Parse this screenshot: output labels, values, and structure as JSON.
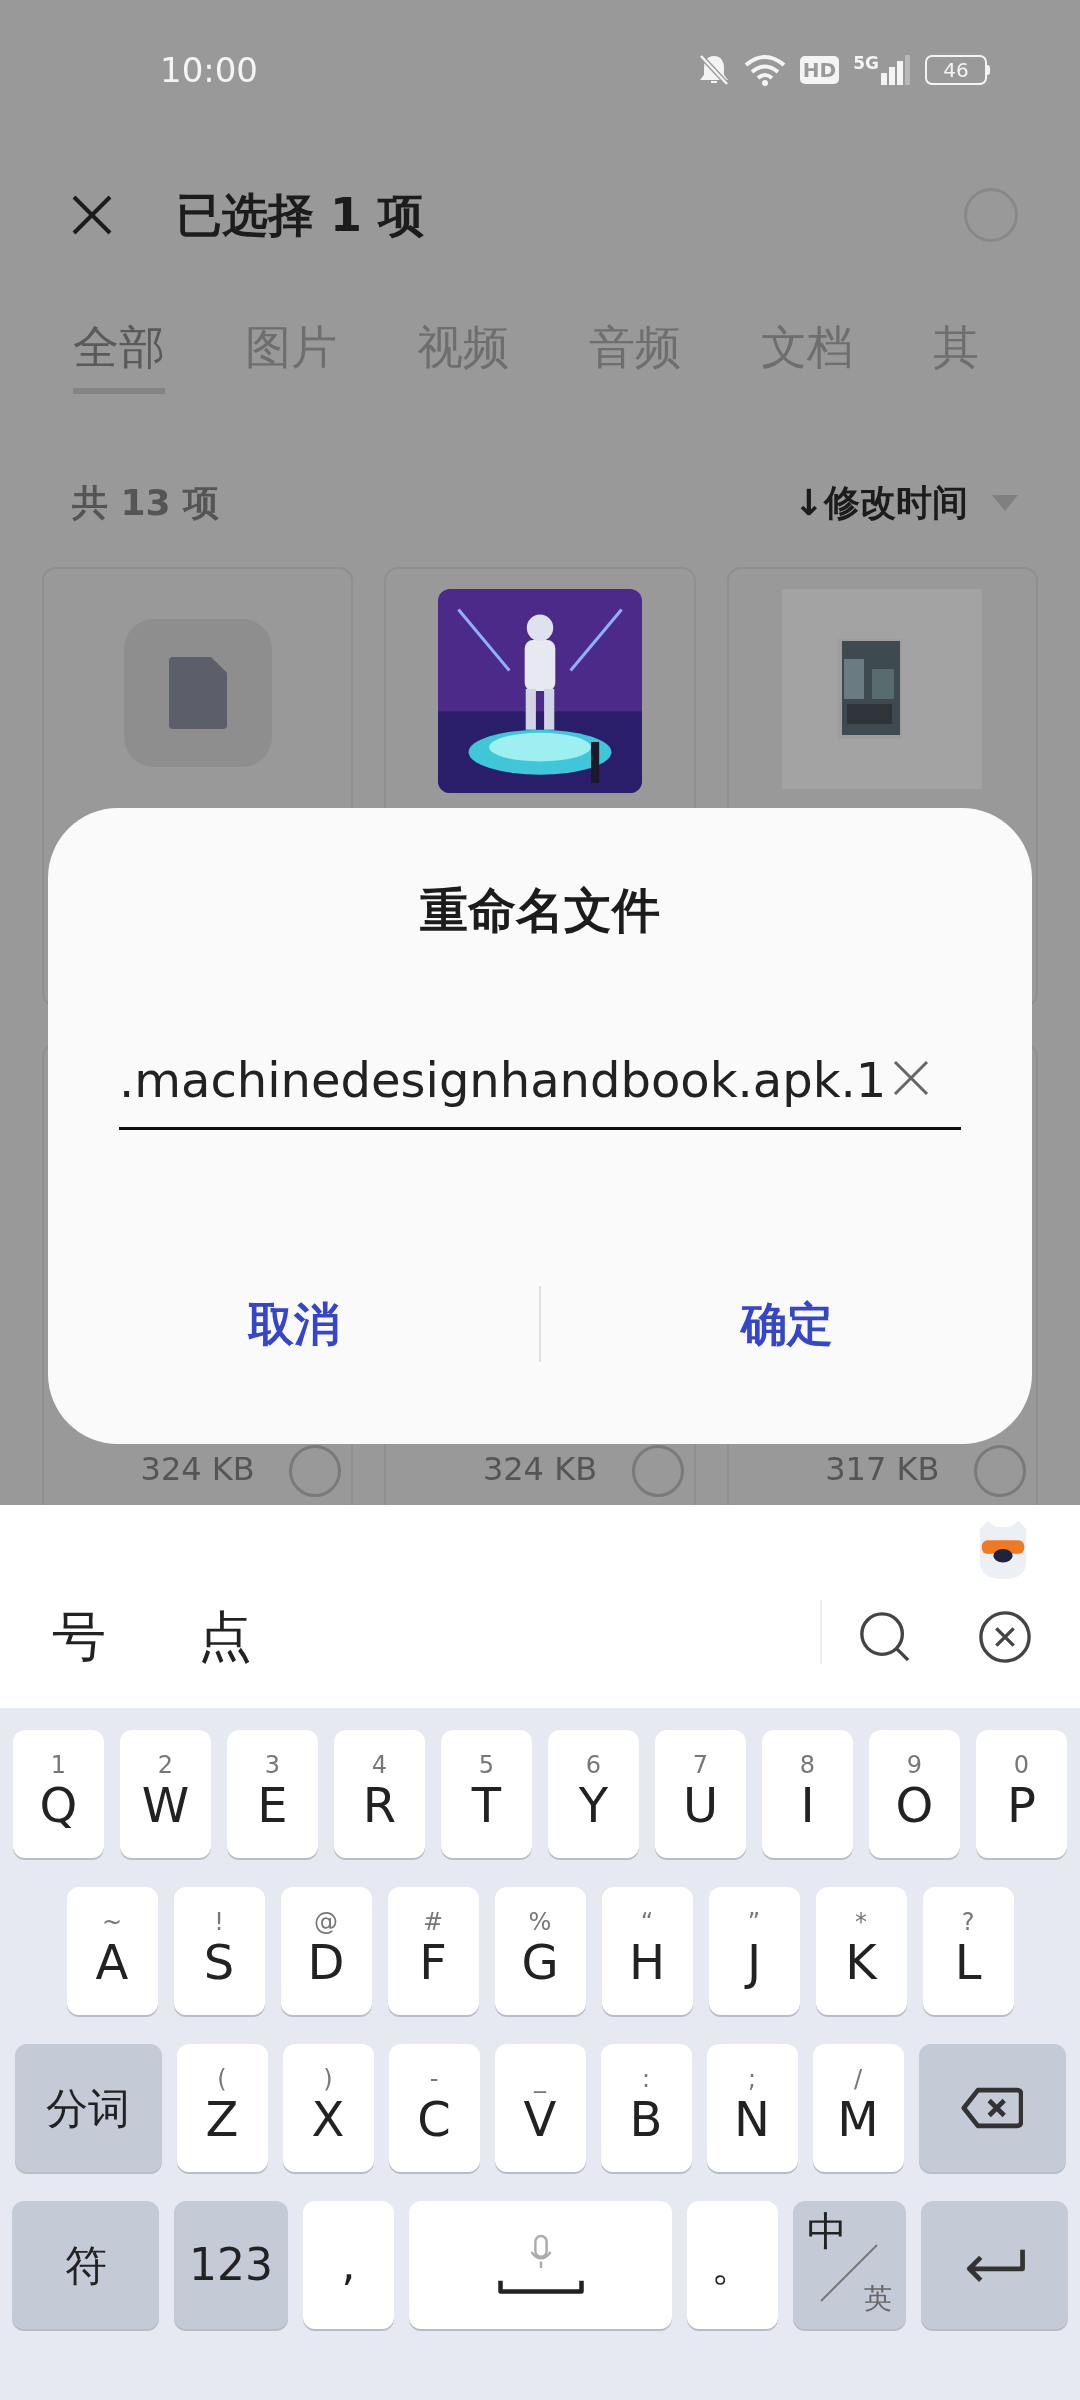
{
  "status_bar": {
    "time": "10:00",
    "network_badge": "HD",
    "network_type": "5G",
    "battery": "46"
  },
  "header": {
    "title": "已选择 1 项",
    "all_selected": false
  },
  "tabs": [
    {
      "label": "全部",
      "selected": true
    },
    {
      "label": "图片",
      "selected": false
    },
    {
      "label": "视频",
      "selected": false
    },
    {
      "label": "音频",
      "selected": false
    },
    {
      "label": "文档",
      "selected": false
    },
    {
      "label": "其",
      "selected": false
    }
  ],
  "list": {
    "count": "共 13 项",
    "sort_label": "↓修改时间"
  },
  "files_top": [
    {
      "kind": "document"
    },
    {
      "kind": "picture"
    },
    {
      "kind": "photo_print"
    }
  ],
  "files_bottom": [
    {
      "size": "324 KB",
      "selected": false
    },
    {
      "size": "324 KB",
      "selected": false
    },
    {
      "size": "317 KB",
      "selected": false
    }
  ],
  "dialog": {
    "title": "重命名文件",
    "value": ".machinedesignhandbook.apk.1",
    "buttons": [
      {
        "label": "取消"
      },
      {
        "label": "确定"
      }
    ]
  },
  "keyboard": {
    "candidates": [
      "号",
      "点"
    ],
    "rows": [
      {
        "keys": [
          {
            "kind": "letter",
            "label": "Q",
            "hint": "1"
          },
          {
            "kind": "letter",
            "label": "W",
            "hint": "2"
          },
          {
            "kind": "letter",
            "label": "E",
            "hint": "3"
          },
          {
            "kind": "letter",
            "label": "R",
            "hint": "4"
          },
          {
            "kind": "letter",
            "label": "T",
            "hint": "5"
          },
          {
            "kind": "letter",
            "label": "Y",
            "hint": "6"
          },
          {
            "kind": "letter",
            "label": "U",
            "hint": "7"
          },
          {
            "kind": "letter",
            "label": "I",
            "hint": "8"
          },
          {
            "kind": "letter",
            "label": "O",
            "hint": "9"
          },
          {
            "kind": "letter",
            "label": "P",
            "hint": "0"
          }
        ]
      },
      {
        "keys": [
          {
            "kind": "letter",
            "label": "A",
            "hint": "~"
          },
          {
            "kind": "letter",
            "label": "S",
            "hint": "!"
          },
          {
            "kind": "letter",
            "label": "D",
            "hint": "@"
          },
          {
            "kind": "letter",
            "label": "F",
            "hint": "#"
          },
          {
            "kind": "letter",
            "label": "G",
            "hint": "%"
          },
          {
            "kind": "letter",
            "label": "H",
            "hint": "“"
          },
          {
            "kind": "letter",
            "label": "J",
            "hint": "”"
          },
          {
            "kind": "letter",
            "label": "K",
            "hint": "*"
          },
          {
            "kind": "letter",
            "label": "L",
            "hint": "?"
          }
        ]
      },
      {
        "keys": [
          {
            "kind": "function",
            "label": "分词"
          },
          {
            "kind": "letter",
            "label": "Z",
            "hint": "("
          },
          {
            "kind": "letter",
            "label": "X",
            "hint": ")"
          },
          {
            "kind": "letter",
            "label": "C",
            "hint": "-"
          },
          {
            "kind": "letter",
            "label": "V",
            "hint": "_"
          },
          {
            "kind": "letter",
            "label": "B",
            "hint": ":"
          },
          {
            "kind": "letter",
            "label": "N",
            "hint": ";"
          },
          {
            "kind": "letter",
            "label": "M",
            "hint": "/"
          },
          {
            "kind": "backspace"
          }
        ]
      },
      {
        "keys": [
          {
            "kind": "function",
            "label": "符"
          },
          {
            "kind": "number",
            "label": "123"
          },
          {
            "kind": "punct",
            "label": ","
          },
          {
            "kind": "space"
          },
          {
            "kind": "punct",
            "label": "。"
          },
          {
            "kind": "lang",
            "label": "中",
            "sub": "英"
          },
          {
            "kind": "enter"
          }
        ]
      }
    ]
  }
}
